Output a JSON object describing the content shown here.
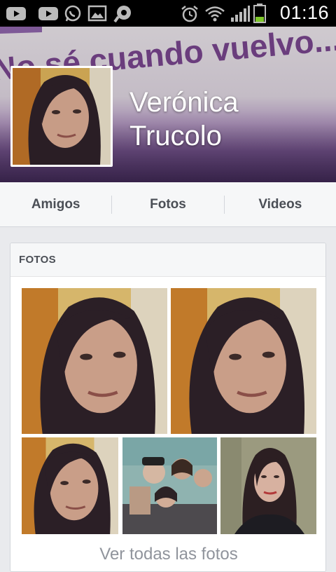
{
  "status_bar": {
    "time": "01:16",
    "icons": [
      "youtube-icon",
      "youtube-icon",
      "whatsapp-icon",
      "gallery-icon",
      "messenger-icon",
      "alarm-icon",
      "wifi-icon",
      "signal-icon",
      "battery-icon"
    ]
  },
  "profile": {
    "name": "Verónica Trucolo",
    "cover_text": "No sé cuando vuelvo..."
  },
  "tabs": [
    {
      "label": "Amigos"
    },
    {
      "label": "Fotos"
    },
    {
      "label": "Videos"
    }
  ],
  "photos_section": {
    "title": "FOTOS",
    "see_all": "Ver todas las fotos"
  },
  "colors": {
    "tab_bg": "#f6f7f8",
    "page_bg": "#e9eaed",
    "text_dark": "#4b4f56",
    "text_muted": "#90949c",
    "cover_text": "#5a2670"
  }
}
